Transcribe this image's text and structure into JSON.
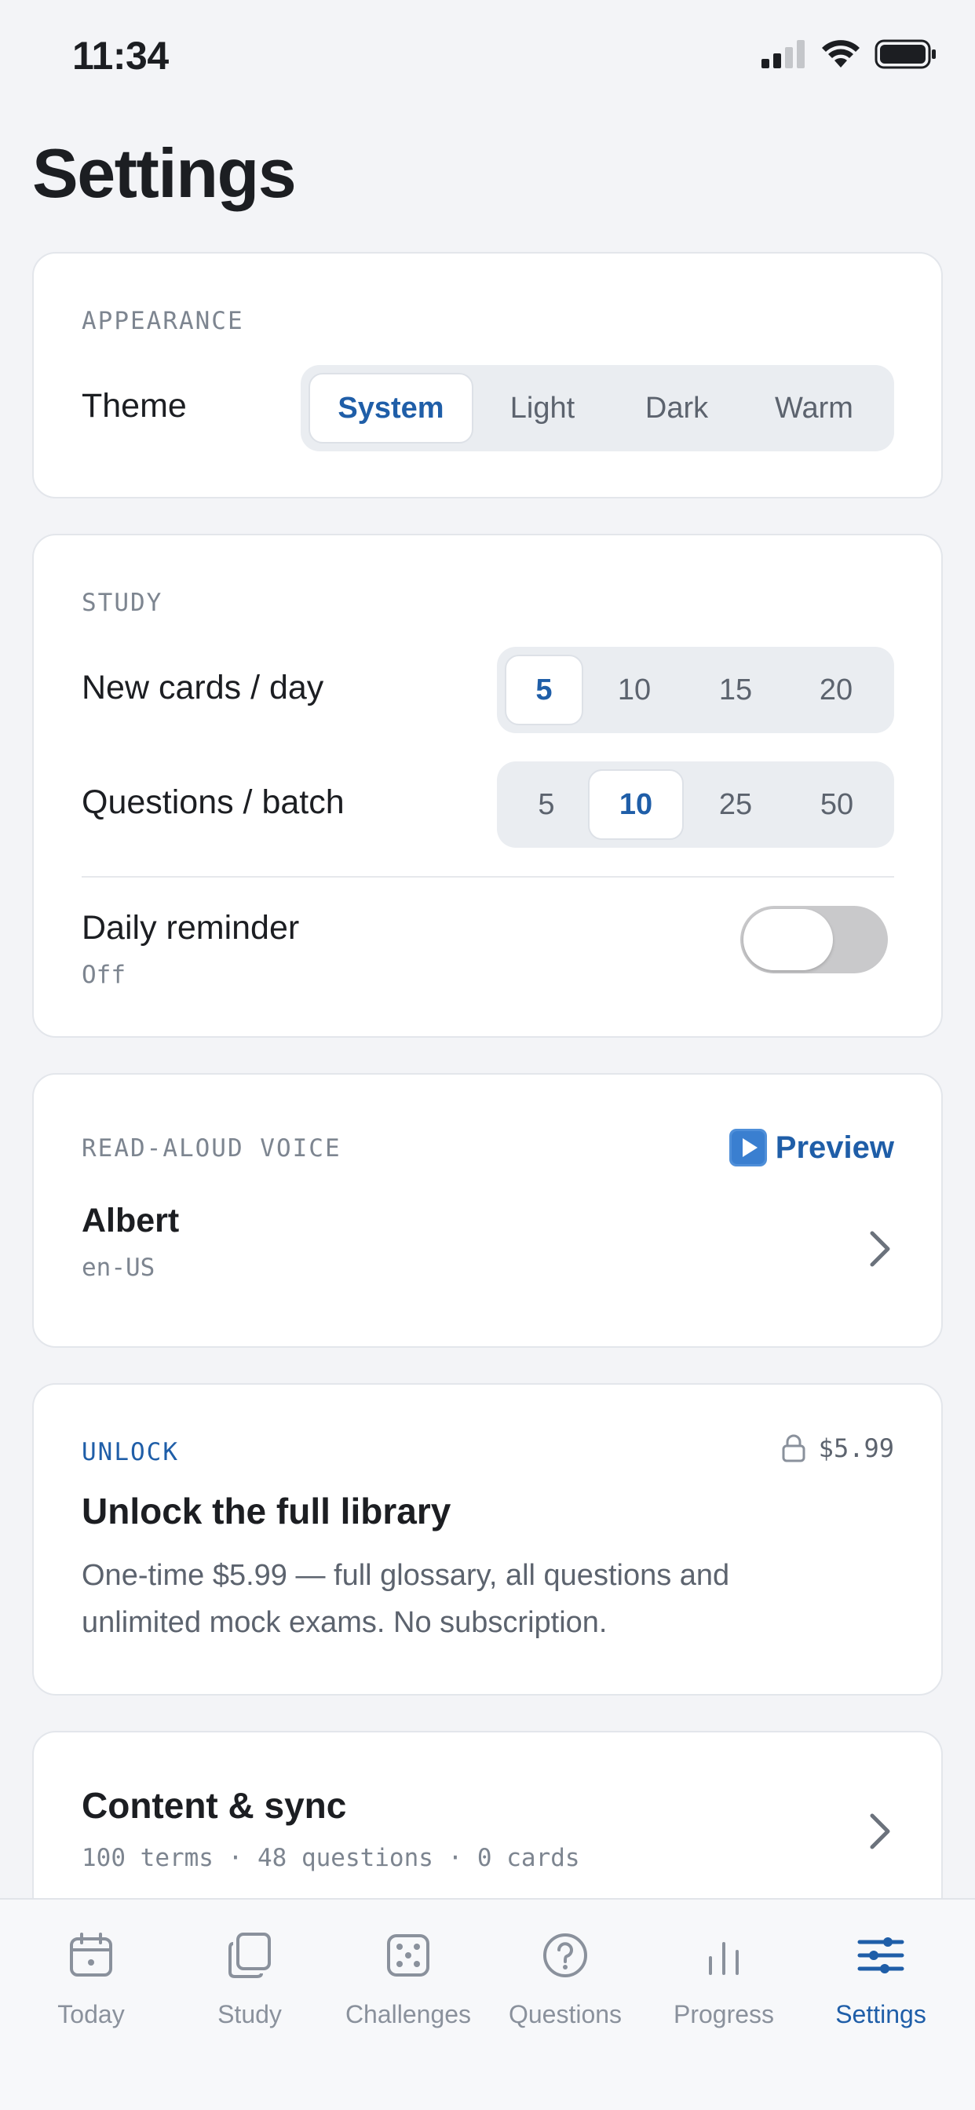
{
  "status_bar": {
    "time": "11:34"
  },
  "page": {
    "title": "Settings"
  },
  "appearance": {
    "section_label": "APPEARANCE",
    "theme_label": "Theme",
    "theme_options": [
      "System",
      "Light",
      "Dark",
      "Warm"
    ],
    "theme_selected": "System"
  },
  "study": {
    "section_label": "STUDY",
    "new_cards_label": "New cards / day",
    "new_cards_options": [
      "5",
      "10",
      "15",
      "20"
    ],
    "new_cards_selected": "5",
    "questions_label": "Questions / batch",
    "questions_options": [
      "5",
      "10",
      "25",
      "50"
    ],
    "questions_selected": "10",
    "reminder_label": "Daily reminder",
    "reminder_status": "Off",
    "reminder_on": false
  },
  "voice": {
    "section_label": "READ-ALOUD VOICE",
    "preview_label": "Preview",
    "preview_icon": "play-button-icon",
    "name": "Albert",
    "locale": "en-US"
  },
  "unlock": {
    "section_label": "UNLOCK",
    "price": "$5.99",
    "title": "Unlock the full library",
    "description_line1": "One-time $5.99 — full glossary, all questions and",
    "description_line2": "unlimited mock exams. No subscription."
  },
  "content_sync": {
    "title": "Content & sync",
    "summary": "100 terms · 48 questions · 0 cards"
  },
  "tabbar": {
    "tabs": [
      {
        "label": "Today",
        "icon": "calendar-icon"
      },
      {
        "label": "Study",
        "icon": "cards-icon"
      },
      {
        "label": "Challenges",
        "icon": "dice-icon"
      },
      {
        "label": "Questions",
        "icon": "question-icon"
      },
      {
        "label": "Progress",
        "icon": "bars-icon"
      },
      {
        "label": "Settings",
        "icon": "sliders-icon"
      }
    ],
    "active": "Settings"
  },
  "colors": {
    "accent": "#1f5ea8",
    "background": "#f3f4f7",
    "card": "#ffffff",
    "muted": "#7d8590"
  }
}
